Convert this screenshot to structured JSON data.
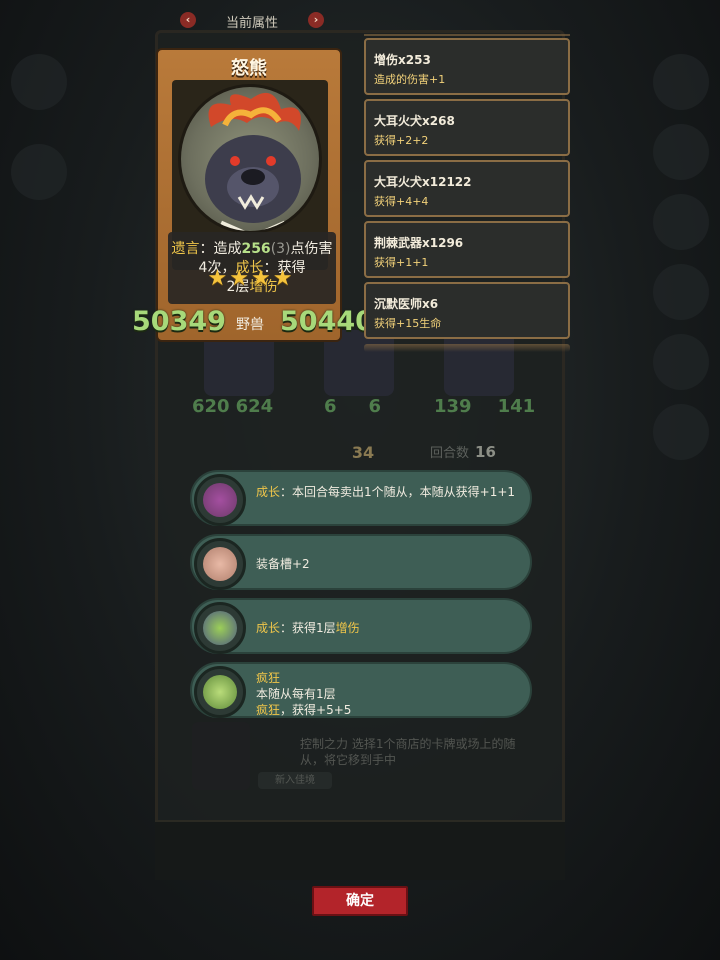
{
  "header": {
    "title": "当前属性",
    "prev_icon": "chevron-left-icon",
    "next_icon": "chevron-right-icon"
  },
  "card": {
    "name": "怒熊",
    "stars": 4,
    "desc": {
      "kw_legacy": "遗言",
      "t1": "：造成",
      "dmg": "256",
      "dmg_paren": "(3)",
      "t2": "点伤害4次，",
      "kw_grow": "成长",
      "t3": "：获得",
      "t4": "2层",
      "kw_dmgup": "增伤"
    },
    "attack": "50349",
    "type": "野兽",
    "health": "50440"
  },
  "buffs": [
    {
      "title": "增伤x253",
      "desc": "造成的伤害+1"
    },
    {
      "title": "大耳火犬x268",
      "desc": "获得+2+2"
    },
    {
      "title": "大耳火犬x12122",
      "desc": "获得+4+4"
    },
    {
      "title": "荆棘武器x1296",
      "desc": "获得+1+1"
    },
    {
      "title": "沉默医师x6",
      "desc": "获得+15生命"
    }
  ],
  "effects": [
    {
      "kw": "成长",
      "text": "：本回合每卖出1个随从，本随从获得+1+1",
      "icon": "thorn-vine-icon"
    },
    {
      "kw": "",
      "text": "装备槽+2",
      "icon": "pig-icon"
    },
    {
      "kw": "成长",
      "text": "：获得1层",
      "kw2": "增伤",
      "icon": "potion-icon"
    },
    {
      "kw": "疯狂",
      "line2": "本随从每有1层",
      "kw3": "疯狂",
      "line3": "，获得+5+5",
      "icon": "frenzy-vine-icon"
    }
  ],
  "background": {
    "minion_stats": [
      [
        "620",
        "624"
      ],
      [
        "6",
        "6"
      ],
      [
        "139",
        "141"
      ]
    ],
    "round_label": "回合数",
    "round_value": "16",
    "level": "34",
    "hero_skill_text": "控制之力 选择1个商店的卡牌或场上的随从，将它移到手中",
    "hero_button": "新入佳境"
  },
  "confirm_label": "确定",
  "colors": {
    "accent_red": "#b3242a",
    "stat_green": "#a7d97a",
    "keyword_yellow": "#f0c64a",
    "pill_teal": "#3e5e55",
    "card_frame": "#b97a3a"
  }
}
